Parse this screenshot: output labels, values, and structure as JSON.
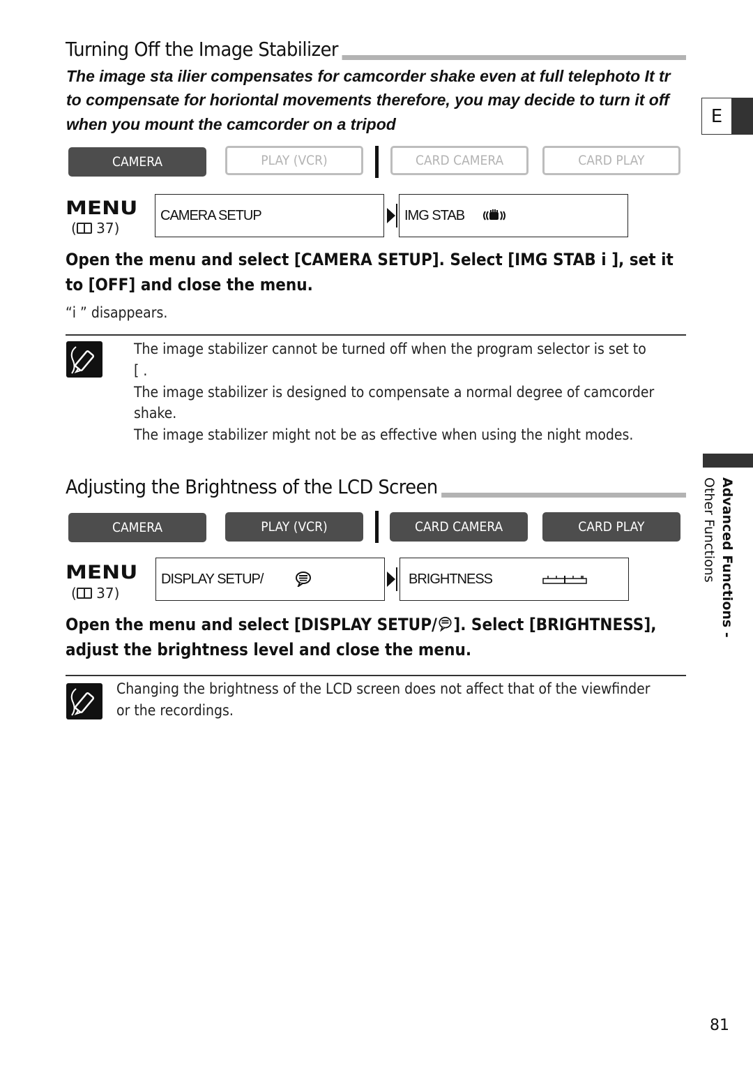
{
  "side_tab": {
    "letter": "E"
  },
  "side_chapter": {
    "bold": "Advanced Functions -",
    "normal": "Other Functions"
  },
  "page_number": "81",
  "section1": {
    "title": "Turning Off the Image Stabilizer",
    "intro_lines": [
      "The image sta  ilier compensates for camcorder shake even at full telephoto  It tr",
      "to compensate for horiontal movements  therefore, you may decide to turn it off",
      "when you mount the camcorder on a tripod"
    ],
    "modes": [
      {
        "label": "CAMERA",
        "active": true
      },
      {
        "label": "PLAY (VCR)",
        "active": false
      },
      {
        "label": "CARD CAMERA",
        "active": false
      },
      {
        "label": "CARD PLAY",
        "active": false
      }
    ],
    "menu": {
      "word": "MENU",
      "ref_page": "37)",
      "ref_open": "(",
      "icon": "book-icon"
    },
    "menu_path": [
      {
        "label": "CAMERA SETUP"
      },
      {
        "label": "IMG STAB",
        "icon": "hand-shake-icon"
      }
    ],
    "step_lines": [
      "Open the menu and select [CAMERA SETUP]. Select [IMG STAB i    ], set it",
      "to [OFF] and close the menu."
    ],
    "result": "“i    ” disappears.",
    "notes": [
      "The image stabilizer cannot be turned off when the program selector is set to",
      "[    .",
      "The image stabilizer is designed to compensate a normal degree of camcorder",
      "shake.",
      "The image stabilizer might not be as effective when using the night modes."
    ]
  },
  "section2": {
    "title": "Adjusting the Brightness of the LCD Screen",
    "modes": [
      {
        "label": "CAMERA",
        "active": true
      },
      {
        "label": "PLAY (VCR)",
        "active": true
      },
      {
        "label": "CARD CAMERA",
        "active": true
      },
      {
        "label": "CARD PLAY",
        "active": true
      }
    ],
    "menu": {
      "word": "MENU",
      "ref_page": "37)",
      "ref_open": "(",
      "icon": "book-icon"
    },
    "menu_path": [
      {
        "label": "DISPLAY SETUP/",
        "icon": "speech-bubble-icon"
      },
      {
        "label": "BRIGHTNESS",
        "icon": "brightness-scale-icon"
      }
    ],
    "step_lines": [
      "Open the menu and select [DISPLAY SETUP/",
      "]. Select [BRIGHTNESS],",
      "adjust the brightness level and close the menu."
    ],
    "notes": [
      "Changing the brightness of the LCD screen does not affect that of the viewfinder",
      "or the recordings."
    ]
  }
}
